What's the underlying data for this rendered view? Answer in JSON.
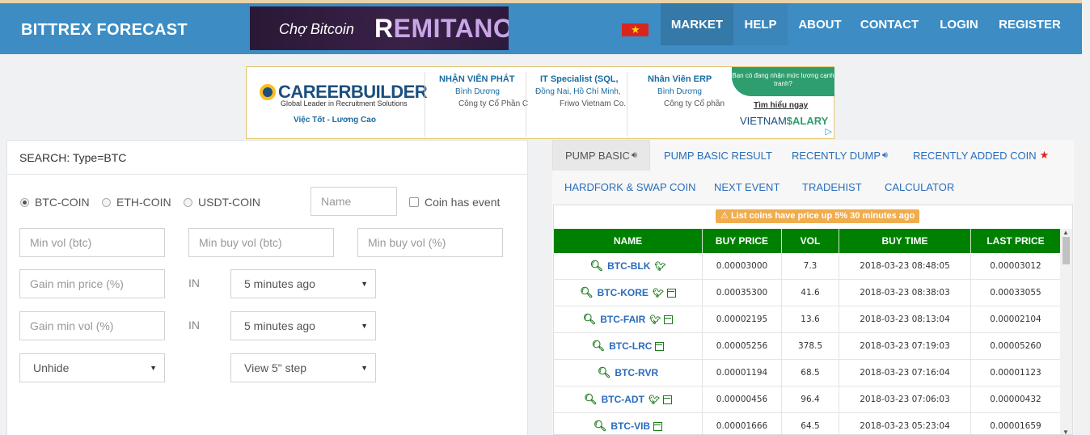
{
  "brand": "BITTREX FORECAST",
  "remitano_ad": {
    "tagline": "Chợ Bitcoin",
    "name_first": "R",
    "name_rest": "EMITANO"
  },
  "nav": [
    {
      "label": "MARKET"
    },
    {
      "label": "HELP"
    },
    {
      "label": "ABOUT"
    },
    {
      "label": "CONTACT"
    },
    {
      "label": "LOGIN"
    },
    {
      "label": "REGISTER"
    }
  ],
  "career_ad": {
    "logo": "CAREERBUILDER",
    "sub": "Global Leader in Recruitment Solutions",
    "tag": "Việc Tốt - Lương Cao",
    "jobs": [
      {
        "title": "NHẬN VIÊN PHÁT",
        "location": "Bình Dương",
        "company": "Công ty Cổ Phần C"
      },
      {
        "title": "IT Specialist (SQL,",
        "location": "Đồng Nai, Hồ Chí Minh,",
        "company": "Friwo Vietnam Co."
      },
      {
        "title": "Nhân Viên ERP",
        "location": "Bình Dương",
        "company": "Công ty Cổ phần"
      }
    ],
    "salary_question": "Bạn có đang nhận mức lương cạnh tranh?",
    "salary_link": "Tìm hiểu ngay",
    "salary_logo_a": "VIETNAM",
    "salary_logo_b": "$ALARY"
  },
  "search": {
    "title": "SEARCH: Type=BTC",
    "radios": [
      "BTC-COIN",
      "ETH-COIN",
      "USDT-COIN"
    ],
    "name_placeholder": "Name",
    "event_label": "Coin has event",
    "min_vol": "Min vol (btc)",
    "min_buy_vol": "Min buy vol (btc)",
    "min_buy_vol_pct": "Min buy vol (%)",
    "gain_min_price": "Gain min price (%)",
    "gain_min_vol": "Gain min vol (%)",
    "in_label": "IN",
    "time_select_1": "5 minutes ago",
    "time_select_2": "5 minutes ago",
    "hide_select": "Unhide",
    "step_select": "View 5\" step"
  },
  "tabs": {
    "row1": [
      "PUMP BASIC",
      "PUMP BASIC RESULT",
      "RECENTLY DUMP",
      "RECENTLY ADDED COIN"
    ],
    "row2": [
      "HARDFORK & SWAP COIN",
      "NEXT EVENT",
      "TRADEHIST",
      "CALCULATOR"
    ]
  },
  "table": {
    "notice": "List coins have price up 5% 30 minutes ago",
    "headers": [
      "NAME",
      "BUY PRICE",
      "VOL",
      "BUY TIME",
      "LAST PRICE"
    ],
    "rows": [
      {
        "name": "BTC-BLK",
        "buy_price": "0.00003000",
        "vol": "7.3",
        "buy_time": "2018-03-23 08:48:05",
        "last_price": "0.00003012"
      },
      {
        "name": "BTC-KORE",
        "buy_price": "0.00035300",
        "vol": "41.6",
        "buy_time": "2018-03-23 08:38:03",
        "last_price": "0.00033055"
      },
      {
        "name": "BTC-FAIR",
        "buy_price": "0.00002195",
        "vol": "13.6",
        "buy_time": "2018-03-23 08:13:04",
        "last_price": "0.00002104"
      },
      {
        "name": "BTC-LRC",
        "buy_price": "0.00005256",
        "vol": "378.5",
        "buy_time": "2018-03-23 07:19:03",
        "last_price": "0.00005260"
      },
      {
        "name": "BTC-RVR",
        "buy_price": "0.00001194",
        "vol": "68.5",
        "buy_time": "2018-03-23 07:16:04",
        "last_price": "0.00001123"
      },
      {
        "name": "BTC-ADT",
        "buy_price": "0.00000456",
        "vol": "96.4",
        "buy_time": "2018-03-23 07:06:03",
        "last_price": "0.00000432"
      },
      {
        "name": "BTC-VIB",
        "buy_price": "0.00001666",
        "vol": "64.5",
        "buy_time": "2018-03-23 05:23:04",
        "last_price": "0.00001659"
      }
    ]
  }
}
